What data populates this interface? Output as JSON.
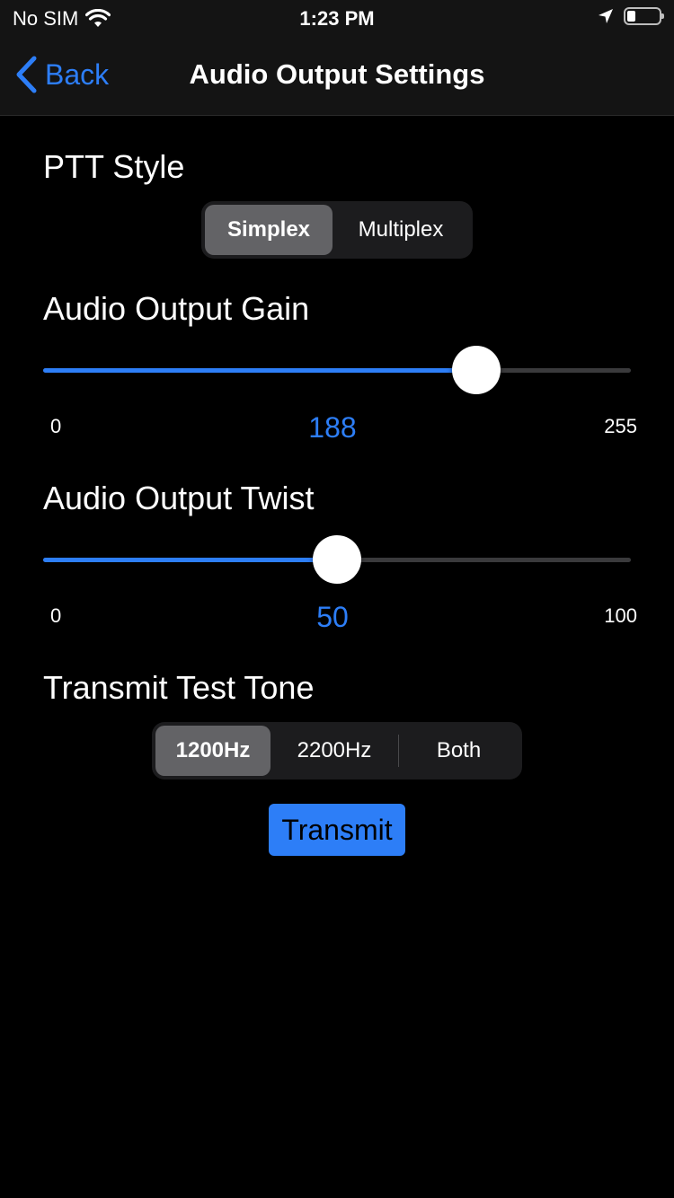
{
  "status_bar": {
    "carrier": "No SIM",
    "time": "1:23 PM",
    "icons": [
      "wifi-icon",
      "location-arrow-icon",
      "battery-icon"
    ],
    "battery_level": 0.25
  },
  "nav": {
    "back_label": "Back",
    "title": "Audio Output Settings",
    "accent_color": "#2d7ef7"
  },
  "ptt": {
    "title": "PTT Style",
    "options": [
      "Simplex",
      "Multiplex"
    ],
    "selected": "Simplex"
  },
  "gain": {
    "title": "Audio Output Gain",
    "min": "0",
    "max": "255",
    "value": 188
  },
  "twist": {
    "title": "Audio Output Twist",
    "min": "0",
    "max": "100",
    "value": 50
  },
  "tone": {
    "title": "Transmit Test Tone",
    "options": [
      "1200Hz",
      "2200Hz",
      "Both"
    ],
    "selected": "1200Hz",
    "transmit_label": "Transmit"
  }
}
